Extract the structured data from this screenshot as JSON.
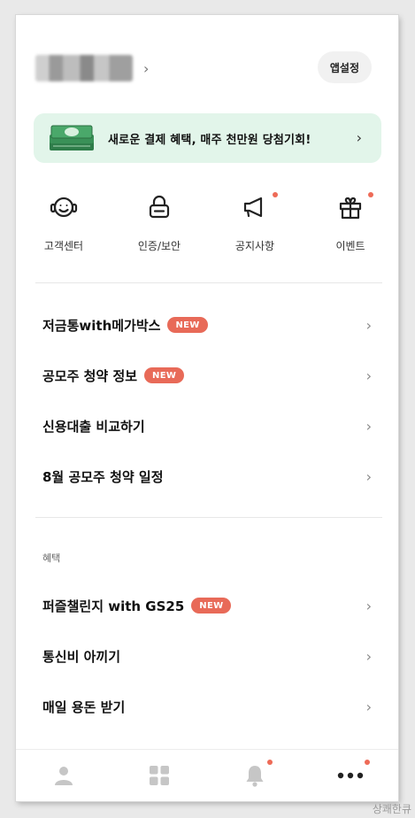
{
  "header": {
    "settings_label": "앱설정"
  },
  "banner": {
    "text": "새로운 결제 혜택, 매주 천만원 당첨기회!",
    "icon": "money-stack-icon"
  },
  "quick_menu": [
    {
      "label": "고객센터",
      "icon": "headset-smile-icon",
      "dot": false
    },
    {
      "label": "인증/보안",
      "icon": "lock-icon",
      "dot": false
    },
    {
      "label": "공지사항",
      "icon": "megaphone-icon",
      "dot": true
    },
    {
      "label": "이벤트",
      "icon": "gift-icon",
      "dot": true
    }
  ],
  "menu": [
    {
      "title": "저금통with메가박스",
      "badge": "NEW"
    },
    {
      "title": "공모주 청약 정보",
      "badge": "NEW"
    },
    {
      "title": "신용대출 비교하기",
      "badge": ""
    },
    {
      "title": "8월 공모주 청약 일정",
      "badge": ""
    }
  ],
  "benefits": {
    "section_label": "혜택",
    "items": [
      {
        "title": "퍼즐챌린지 with GS25",
        "badge": "NEW"
      },
      {
        "title": "통신비 아끼기",
        "badge": ""
      },
      {
        "title": "매일 용돈 받기",
        "badge": ""
      }
    ]
  },
  "bottom_nav": [
    {
      "icon": "person-icon",
      "dot": false
    },
    {
      "icon": "grid-icon",
      "dot": false
    },
    {
      "icon": "bell-icon",
      "dot": true
    },
    {
      "icon": "more-icon",
      "dot": true
    }
  ],
  "colors": {
    "accent_badge": "#e86a58",
    "banner_bg": "#e2f5ea",
    "notify_dot": "#ee6b57"
  },
  "watermark": "상쾌한큐"
}
